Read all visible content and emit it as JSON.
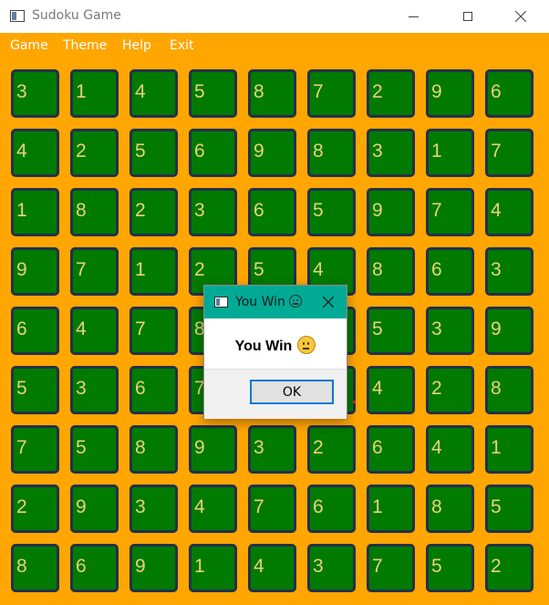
{
  "window": {
    "title": "Sudoku Game"
  },
  "menu": {
    "items": [
      "Game",
      "Theme",
      "Help",
      "Exit"
    ]
  },
  "colors": {
    "background": "#ffa600",
    "cell": "#007a00",
    "cell_border": "#23304a",
    "digit": "#e8d27a",
    "dialog_title_bar": "#00aa95"
  },
  "board": [
    [
      "3",
      "1",
      "4",
      "5",
      "8",
      "7",
      "2",
      "9",
      "6"
    ],
    [
      "4",
      "2",
      "5",
      "6",
      "9",
      "8",
      "3",
      "1",
      "7"
    ],
    [
      "1",
      "8",
      "2",
      "3",
      "6",
      "5",
      "9",
      "7",
      "4"
    ],
    [
      "9",
      "7",
      "1",
      "2",
      "5",
      "4",
      "8",
      "6",
      "3"
    ],
    [
      "6",
      "4",
      "7",
      "8",
      "",
      "",
      "5",
      "3",
      "9"
    ],
    [
      "5",
      "3",
      "6",
      "7",
      "",
      "",
      "4",
      "2",
      "8"
    ],
    [
      "7",
      "5",
      "8",
      "9",
      "3",
      "2",
      "6",
      "4",
      "1"
    ],
    [
      "2",
      "9",
      "3",
      "4",
      "7",
      "6",
      "1",
      "8",
      "5"
    ],
    [
      "8",
      "6",
      "9",
      "1",
      "4",
      "3",
      "7",
      "5",
      "2"
    ]
  ],
  "dialog": {
    "title": "You Win",
    "message": "You Win",
    "emoji_icon": "neutral-face-icon",
    "ok_label": "OK"
  }
}
